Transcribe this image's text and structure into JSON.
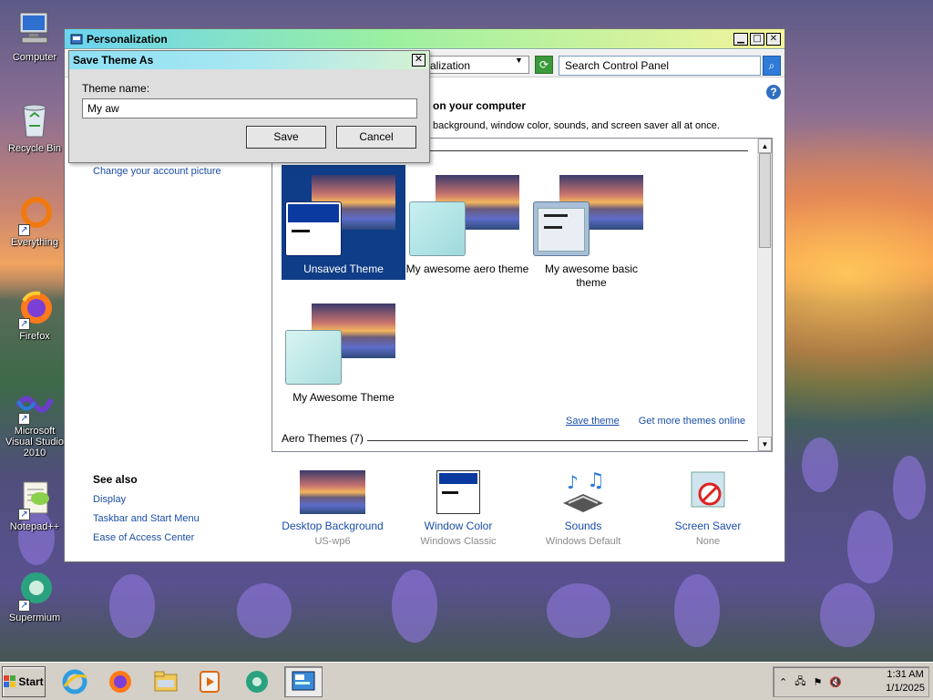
{
  "desktop": {
    "icons": [
      {
        "label": "Computer",
        "icon": "computer-icon"
      },
      {
        "label": "Recycle Bin",
        "icon": "recycle-bin-icon"
      },
      {
        "label": "Everything",
        "icon": "everything-icon"
      },
      {
        "label": "Firefox",
        "icon": "firefox-icon"
      },
      {
        "label": "Microsoft Visual Studio 2010",
        "icon": "visual-studio-icon"
      },
      {
        "label": "Notepad++",
        "icon": "notepad-plus-plus-icon"
      },
      {
        "label": "Supermium",
        "icon": "supermium-icon"
      }
    ]
  },
  "window": {
    "title": "Personalization",
    "address_text": "alization",
    "search_placeholder": "Search Control Panel",
    "heading": "on your computer",
    "subtext": "background, window color, sounds, and screen saver all at once.",
    "left_link": "Change your account picture",
    "themes": [
      {
        "label": "Unsaved Theme"
      },
      {
        "label": "My awesome aero theme"
      },
      {
        "label": "My awesome basic theme"
      },
      {
        "label": "My Awesome Theme"
      }
    ],
    "save_theme_link": "Save theme",
    "get_more_link": "Get more themes online",
    "aero_header": "Aero Themes (7)",
    "see_also": {
      "title": "See also",
      "links": [
        "Display",
        "Taskbar and Start Menu",
        "Ease of Access Center"
      ]
    },
    "bottom_items": [
      {
        "label": "Desktop Background",
        "sub": "US-wp6"
      },
      {
        "label": "Window Color",
        "sub": "Windows Classic"
      },
      {
        "label": "Sounds",
        "sub": "Windows Default"
      },
      {
        "label": "Screen Saver",
        "sub": "None"
      }
    ]
  },
  "dialog": {
    "title": "Save Theme As",
    "field_label": "Theme name:",
    "field_value": "My aw",
    "save_label": "Save",
    "cancel_label": "Cancel"
  },
  "taskbar": {
    "start_label": "Start",
    "clock_time": "1:31 AM",
    "clock_date": "1/1/2025"
  },
  "colors": {
    "selection": "#0f3d88",
    "link": "#1a4ea8",
    "taskbar": "#d4d0c8"
  }
}
